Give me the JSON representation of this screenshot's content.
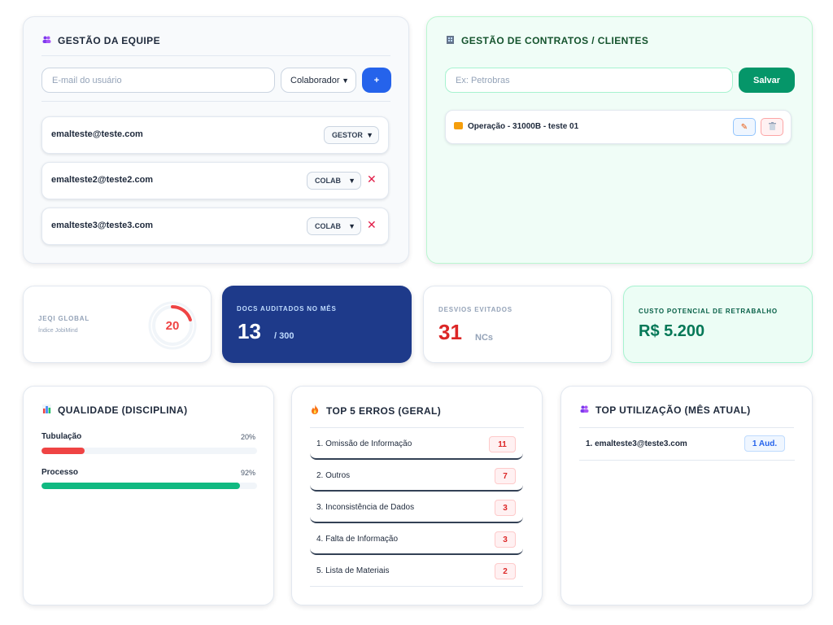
{
  "team": {
    "title": "GESTÃO DA EQUIPE",
    "icon": "people-icon",
    "email_placeholder": "E-mail do usuário",
    "role_select": "Colaborador",
    "add_label": "+",
    "members": [
      {
        "email": "emalteste@teste.com",
        "role": "GESTOR",
        "removable": false
      },
      {
        "email": "emalteste2@teste2.com",
        "role": "COLAB",
        "removable": true
      },
      {
        "email": "emalteste3@teste3.com",
        "role": "COLAB",
        "removable": true
      }
    ],
    "remove_glyph": "✕"
  },
  "contracts": {
    "title": "GESTÃO DE CONTRATOS / CLIENTES",
    "icon": "building-icon",
    "placeholder": "Ex: Petrobras",
    "save_label": "Salvar",
    "items": [
      {
        "name": "Operação - 31000B - teste 01"
      }
    ],
    "edit_glyph": "✎",
    "delete_glyph": "🗑"
  },
  "kpis": {
    "jeqi": {
      "label": "JEQI GLOBAL",
      "sub": "Índice JobiMind",
      "value": "20",
      "fraction": 0.2,
      "color": "#ef4444"
    },
    "docs": {
      "label": "DOCS AUDITADOS NO MÊS",
      "value": "13",
      "total": "/ 300"
    },
    "desvios": {
      "label": "DESVIOS EVITADOS",
      "value": "31",
      "unit": "NCs"
    },
    "custo": {
      "label": "CUSTO POTENCIAL DE RETRABALHO",
      "value": "R$ 5.200"
    }
  },
  "quality": {
    "title": "QUALIDADE (DISCIPLINA)",
    "icon": "bar-chart-icon",
    "bars": [
      {
        "label": "Tubulação",
        "pct": "20%",
        "value": 0.2,
        "color": "#ef4444"
      },
      {
        "label": "Processo",
        "pct": "92%",
        "value": 0.92,
        "color": "#10b981"
      }
    ]
  },
  "errors": {
    "title": "TOP 5 ERROS (GERAL)",
    "icon": "fire-icon",
    "items": [
      {
        "label": "1. Omissão de Informação",
        "count": "11"
      },
      {
        "label": "2. Outros",
        "count": "7"
      },
      {
        "label": "3. Inconsistência de Dados",
        "count": "3"
      },
      {
        "label": "4. Falta de Informação",
        "count": "3"
      },
      {
        "label": "5. Lista de Materiais",
        "count": "2"
      }
    ]
  },
  "usage": {
    "title": "TOP UTILIZAÇÃO (MÊS ATUAL)",
    "icon": "people-icon",
    "items": [
      {
        "label": "1. emalteste3@teste3.com",
        "badge": "1 Aud."
      }
    ]
  }
}
